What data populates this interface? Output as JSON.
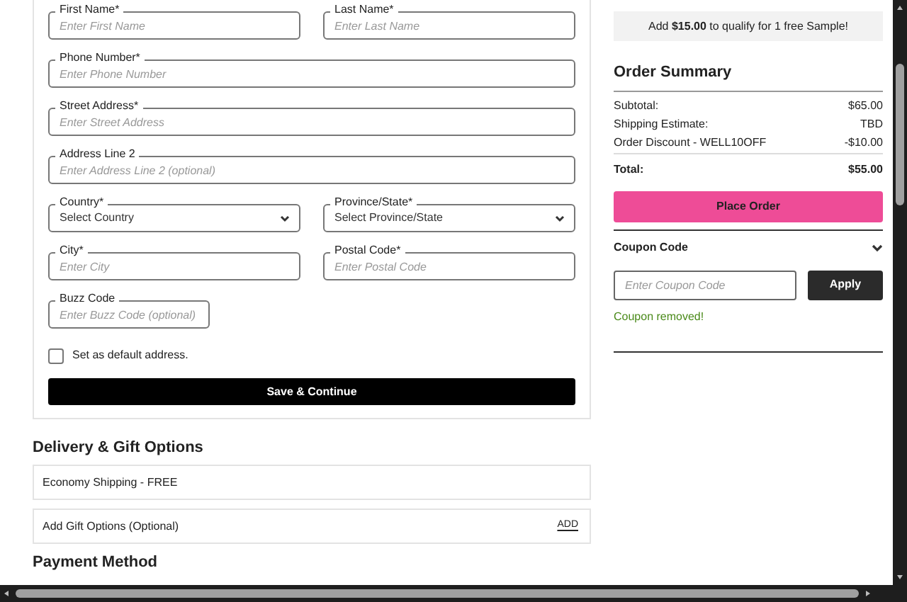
{
  "address_form": {
    "rows": [
      [
        {
          "kind": "text",
          "label": "First Name*",
          "placeholder": "Enter First Name"
        },
        {
          "kind": "text",
          "label": "Last Name*",
          "placeholder": "Enter Last Name"
        }
      ],
      [
        {
          "kind": "text",
          "label": "Phone Number*",
          "placeholder": "Enter Phone Number"
        }
      ],
      [
        {
          "kind": "text",
          "label": "Street Address*",
          "placeholder": "Enter Street Address"
        }
      ],
      [
        {
          "kind": "text",
          "label": "Address Line 2",
          "placeholder": "Enter Address Line 2 (optional)"
        }
      ],
      [
        {
          "kind": "select",
          "label": "Country*",
          "value": "Select Country"
        },
        {
          "kind": "select",
          "label": "Province/State*",
          "value": "Select Province/State"
        }
      ],
      [
        {
          "kind": "text",
          "label": "City*",
          "placeholder": "Enter City"
        },
        {
          "kind": "text",
          "label": "Postal Code*",
          "placeholder": "Enter Postal Code"
        }
      ],
      [
        {
          "kind": "short",
          "label": "Buzz Code",
          "placeholder": "Enter Buzz Code (optional)"
        }
      ]
    ],
    "default_address": {
      "label": "Set as default address.",
      "checked": false
    },
    "save_button": "Save & Continue"
  },
  "delivery": {
    "heading": "Delivery & Gift Options",
    "shipping": "Economy Shipping - FREE",
    "gift": {
      "label": "Add Gift Options (Optional)",
      "action": "ADD"
    }
  },
  "payment": {
    "heading": "Payment Method"
  },
  "summary": {
    "promo": "Add **$15.00** to qualify for 1 free Sample!",
    "heading": "Order Summary",
    "rows": [
      {
        "label": "Subtotal:",
        "value": "$65.00"
      },
      {
        "label": "Shipping Estimate:",
        "value": "TBD"
      },
      {
        "label": "Order Discount - WELL10OFF",
        "value": "-$10.00"
      }
    ],
    "total": {
      "label": "Total:",
      "value": "$55.00"
    },
    "place_order": "Place Order",
    "coupon": {
      "heading": "Coupon Code",
      "expanded": true,
      "placeholder": "Enter Coupon Code",
      "apply": "Apply",
      "message": "Coupon removed!"
    }
  }
}
